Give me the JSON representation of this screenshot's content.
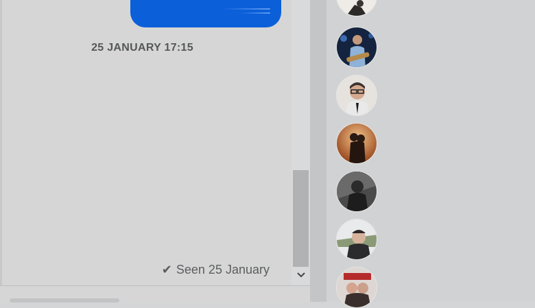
{
  "conversation": {
    "date_divider": "25 JANUARY 17:15",
    "read_receipt": {
      "icon": "checkmark-icon",
      "text": "Seen 25 January"
    },
    "sent_bubble_color": "#0b5fd9"
  },
  "contacts": {
    "avatars": [
      {
        "icon": "contact-avatar"
      },
      {
        "icon": "contact-avatar"
      },
      {
        "icon": "contact-avatar"
      },
      {
        "icon": "contact-avatar"
      },
      {
        "icon": "contact-avatar"
      },
      {
        "icon": "contact-avatar"
      },
      {
        "icon": "contact-avatar"
      }
    ]
  },
  "scrollbar": {
    "down_icon": "chevron-down-icon"
  }
}
